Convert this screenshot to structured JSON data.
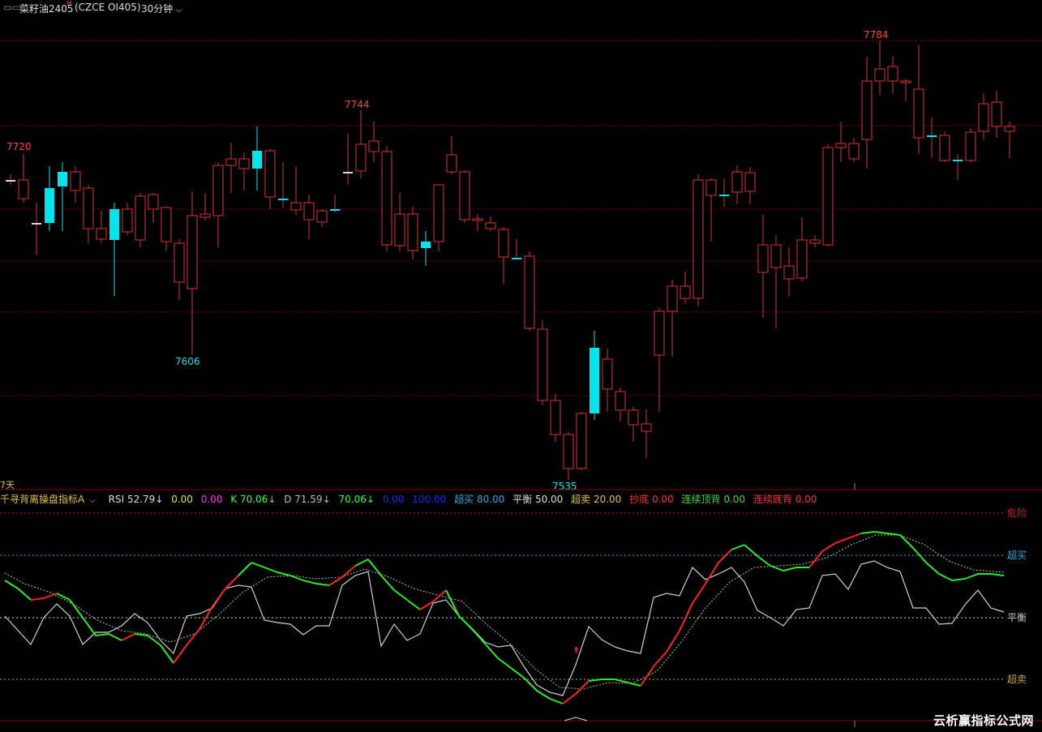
{
  "header": {
    "symbol_name": "菜籽油2405",
    "symbol_sup": "M",
    "exchange_code": "(CZCE OI405)",
    "period": "30分钟"
  },
  "main_chart": {
    "price_labels": {
      "high_left": "7720",
      "high_mid": "7744",
      "high_right": "7784",
      "low_left": "7606",
      "low_mid": "7535"
    },
    "corner_label": "7天",
    "colors": {
      "up": "#ff3b3b",
      "down": "#00e5ee",
      "grid": "#7a0000"
    }
  },
  "indicator": {
    "title": "千寻背离操盘指标A",
    "rsi_label": "RSI 52.79↓",
    "v1": "0.00",
    "v2": "0.00",
    "k_label": "K 70.06↓",
    "d_label": "D 71.59↓",
    "j_value": "70.06↓",
    "v_blue1": "0.00",
    "v_blue2": "100.00",
    "overbought": "超买 80.00",
    "balance": "平衡 50.00",
    "oversold": "超卖 20.00",
    "bottom_fish": "抄底 0.00",
    "top_div": "连续顶背 0.00",
    "bottom_div": "连续底背 0.00",
    "level_labels": {
      "danger": "危险",
      "overbought": "超买",
      "balance": "平衡",
      "oversold": "超卖"
    }
  },
  "watermark": "云析赢指标公式网"
}
